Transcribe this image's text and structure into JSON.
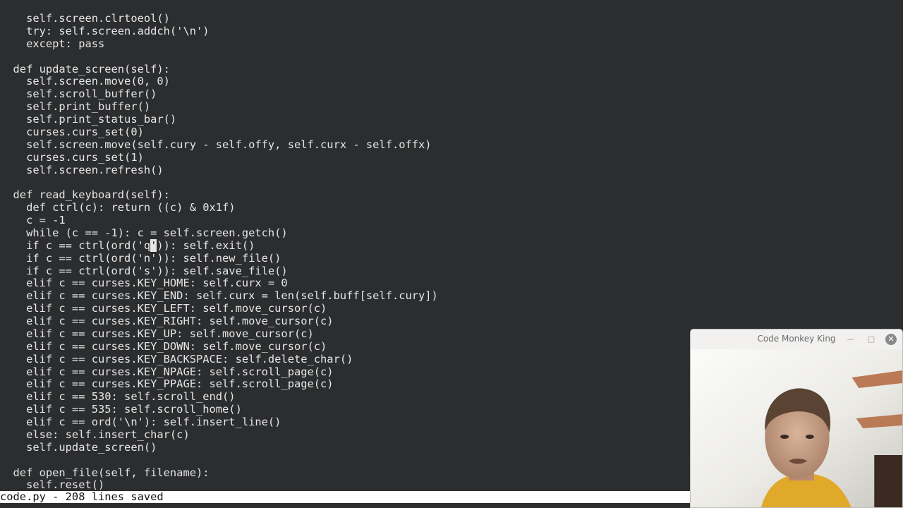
{
  "editor": {
    "lines": [
      "    self.screen.clrtoeol()",
      "    try: self.screen.addch('\\n')",
      "    except: pass",
      "",
      "  def update_screen(self):",
      "    self.screen.move(0, 0)",
      "    self.scroll_buffer()",
      "    self.print_buffer()",
      "    self.print_status_bar()",
      "    curses.curs_set(0)",
      "    self.screen.move(self.cury - self.offy, self.curx - self.offx)",
      "    curses.curs_set(1)",
      "    self.screen.refresh()",
      "",
      "  def read_keyboard(self):",
      "    def ctrl(c): return ((c) & 0x1f)",
      "    c = -1",
      "    while (c == -1): c = self.screen.getch()",
      "    if c == ctrl(ord('q')): self.exit()",
      "    if c == ctrl(ord('n')): self.new_file()",
      "    if c == ctrl(ord('s')): self.save_file()",
      "    elif c == curses.KEY_HOME: self.curx = 0",
      "    elif c == curses.KEY_END: self.curx = len(self.buff[self.cury])",
      "    elif c == curses.KEY_LEFT: self.move_cursor(c)",
      "    elif c == curses.KEY_RIGHT: self.move_cursor(c)",
      "    elif c == curses.KEY_UP: self.move_cursor(c)",
      "    elif c == curses.KEY_DOWN: self.move_cursor(c)",
      "    elif c == curses.KEY_BACKSPACE: self.delete_char()",
      "    elif c == curses.KEY_NPAGE: self.scroll_page(c)",
      "    elif c == curses.KEY_PPAGE: self.scroll_page(c)",
      "    elif c == 530: self.scroll_end()",
      "    elif c == 535: self.scroll_home()",
      "    elif c == ord('\\n'): self.insert_line()",
      "    else: self.insert_char(c)",
      "    self.update_screen()",
      "",
      "  def open_file(self, filename):",
      "    self.reset()"
    ],
    "cursor": {
      "line": 18,
      "column": 23
    }
  },
  "status_bar": {
    "text": "code.py - 208 lines saved"
  },
  "webcam_window": {
    "title": "Code Monkey King",
    "minimize_icon": "minimize-icon",
    "maximize_icon": "maximize-icon",
    "close_icon": "close-icon"
  },
  "colors": {
    "background": "#2c2d2f",
    "text": "#e6e6e6",
    "status_bar_bg": "#ffffff",
    "status_bar_text": "#111111",
    "window_chrome": "#f2f1f0"
  }
}
